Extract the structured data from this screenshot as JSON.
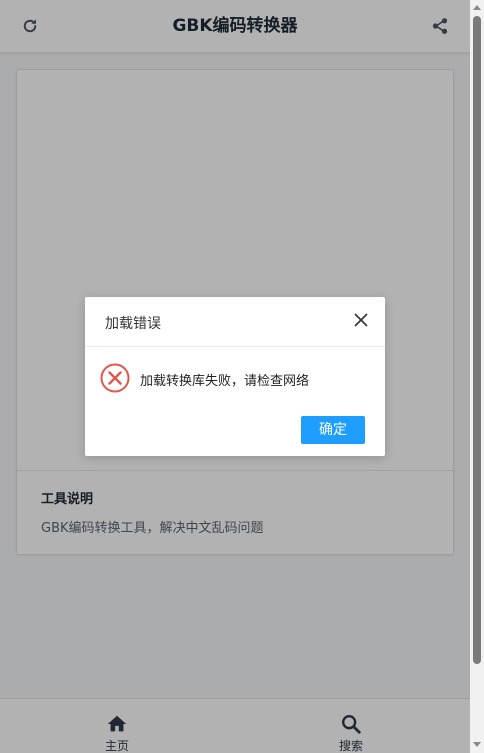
{
  "header": {
    "title": "GBK编码转换器",
    "refresh_icon": "refresh-icon",
    "share_icon": "share-icon"
  },
  "card": {
    "info_title": "工具说明",
    "info_description": "GBK编码转换工具，解决中文乱码问题"
  },
  "bottom_nav": {
    "items": [
      {
        "label": "主页",
        "icon": "home-icon"
      },
      {
        "label": "搜索",
        "icon": "search-icon"
      }
    ]
  },
  "dialog": {
    "title": "加载错误",
    "message": "加载转换库失败，请检查网络",
    "confirm_label": "确定",
    "close_icon": "close-icon",
    "status_icon": "error-circle-icon"
  },
  "colors": {
    "accent": "#1e9fff",
    "error": "#e2574c",
    "text_dark": "#1f2a37",
    "text_muted": "#5b6573"
  }
}
